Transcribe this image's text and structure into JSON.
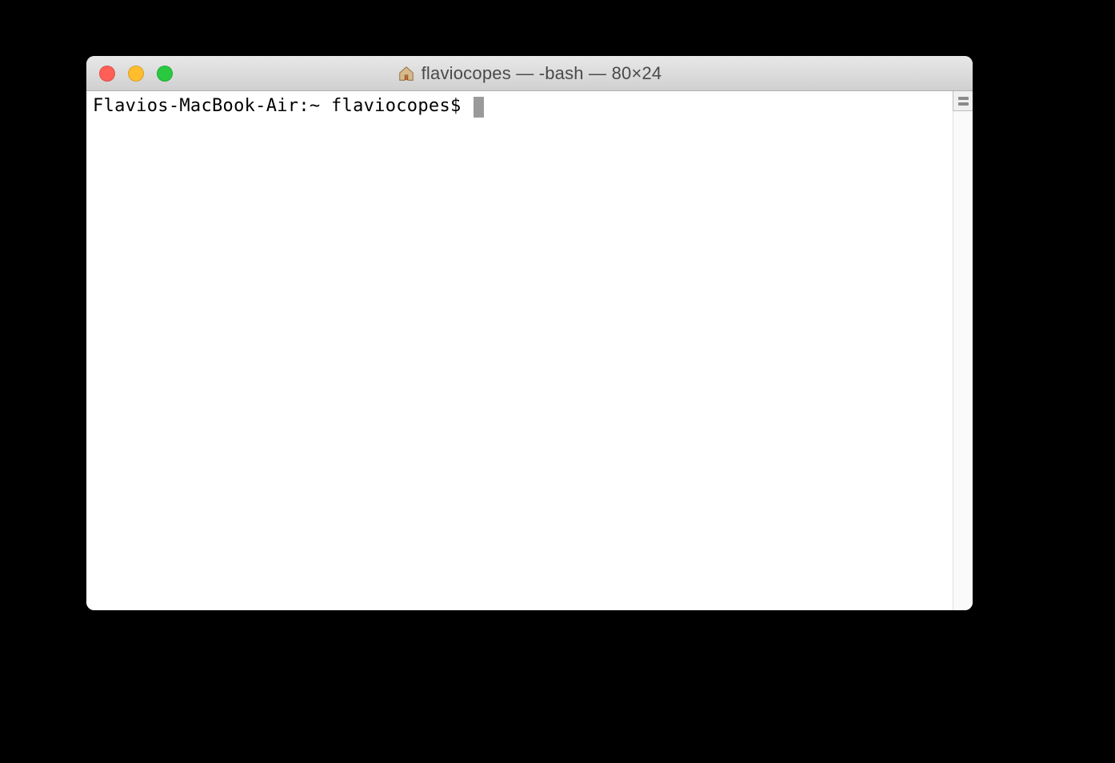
{
  "window": {
    "title": "flaviocopes — -bash — 80×24",
    "icon": "home-folder-icon"
  },
  "terminal": {
    "prompt": "Flavios-MacBook-Air:~ flaviocopes$ "
  },
  "colors": {
    "close": "#ff5f57",
    "minimize": "#ffbd2e",
    "zoom": "#28c940"
  }
}
